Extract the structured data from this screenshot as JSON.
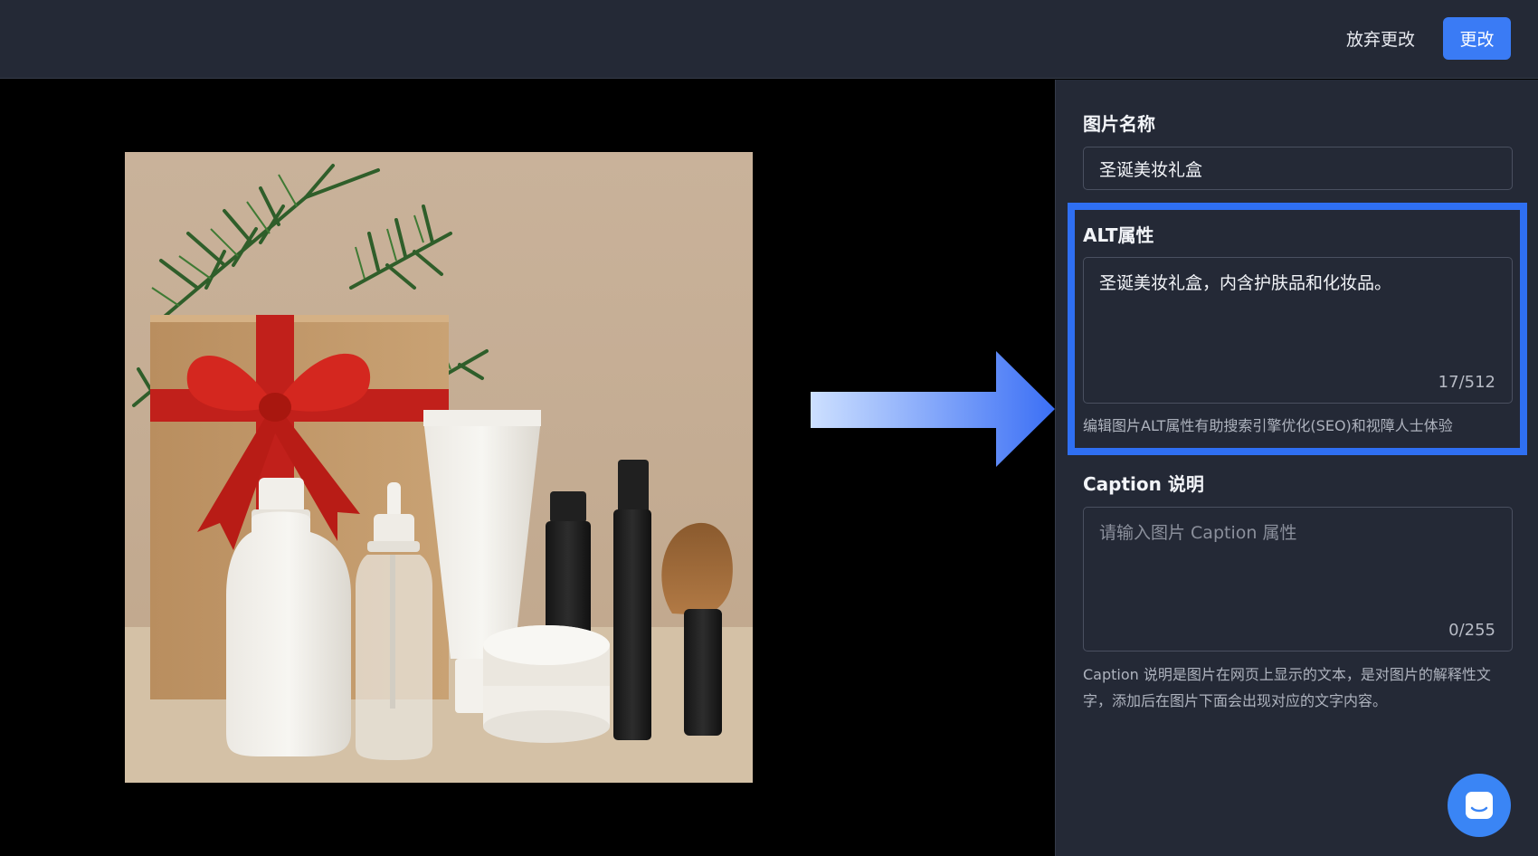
{
  "header": {
    "discard_label": "放弃更改",
    "save_label": "更改"
  },
  "panel": {
    "name_label": "图片名称",
    "name_value": "圣诞美妆礼盒",
    "alt_label": "ALT属性",
    "alt_value": "圣诞美妆礼盒，内含护肤品和化妆品。",
    "alt_counter": "17/512",
    "alt_hint": "编辑图片ALT属性有助搜索引擎优化(SEO)和视障人士体验",
    "caption_label": "Caption 说明",
    "caption_placeholder": "请输入图片 Caption 属性",
    "caption_counter": "0/255",
    "caption_hint": "Caption 说明是图片在网页上显示的文本，是对图片的解释性文字，添加后在图片下面会出现对应的文字内容。"
  },
  "colors": {
    "accent": "#3a7bf5",
    "highlight": "#2f6ff2",
    "panel_bg": "#242936"
  }
}
